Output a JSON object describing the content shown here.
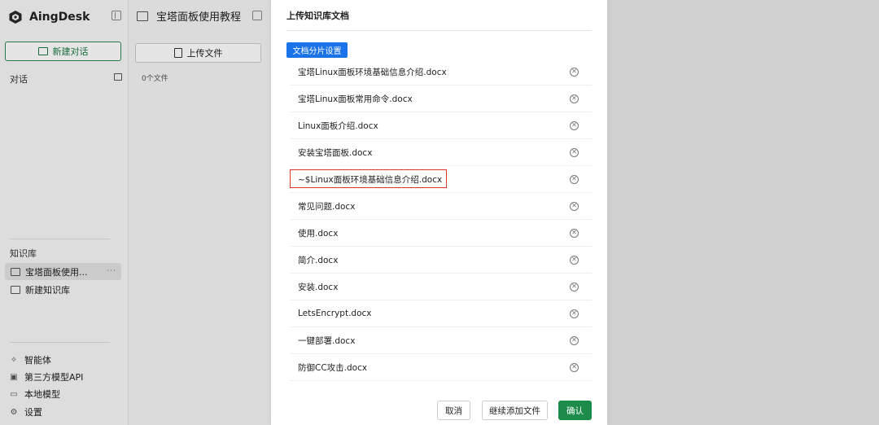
{
  "app": {
    "name": "AingDesk"
  },
  "sidebar": {
    "new_chat": "新建对话",
    "chat_section": "对话",
    "kb_section": "知识库",
    "kb_items": [
      {
        "label": "宝塔面板使用..."
      }
    ],
    "kb_more": "···",
    "kb_new": "新建知识库",
    "bottom": [
      {
        "label": "智能体",
        "icon": "sparkle-icon"
      },
      {
        "label": "第三方模型API",
        "icon": "api-icon"
      },
      {
        "label": "本地模型",
        "icon": "monitor-icon"
      },
      {
        "label": "设置",
        "icon": "gear-icon"
      }
    ]
  },
  "middle": {
    "title": "宝塔面板使用教程",
    "upload": "上传文件",
    "file_count": "0个文件"
  },
  "modal": {
    "title": "上传知识库文档",
    "split_settings": "文档分片设置",
    "files": [
      "宝塔Linux面板环境基础信息介绍.docx",
      "宝塔Linux面板常用命令.docx",
      "Linux面板介绍.docx",
      "安装宝塔面板.docx",
      "~$Linux面板环境基础信息介绍.docx",
      "常见问题.docx",
      "使用.docx",
      "简介.docx",
      "安装.docx",
      "LetsEncrypt.docx",
      "一键部署.docx",
      "防御CC攻击.docx"
    ],
    "remove_glyph": "✕",
    "cancel": "取消",
    "add_more": "继续添加文件",
    "confirm": "确认"
  },
  "colors": {
    "accent_green": "#1d8c4b",
    "accent_blue": "#1a73e8",
    "highlight_red": "#e0352b"
  }
}
